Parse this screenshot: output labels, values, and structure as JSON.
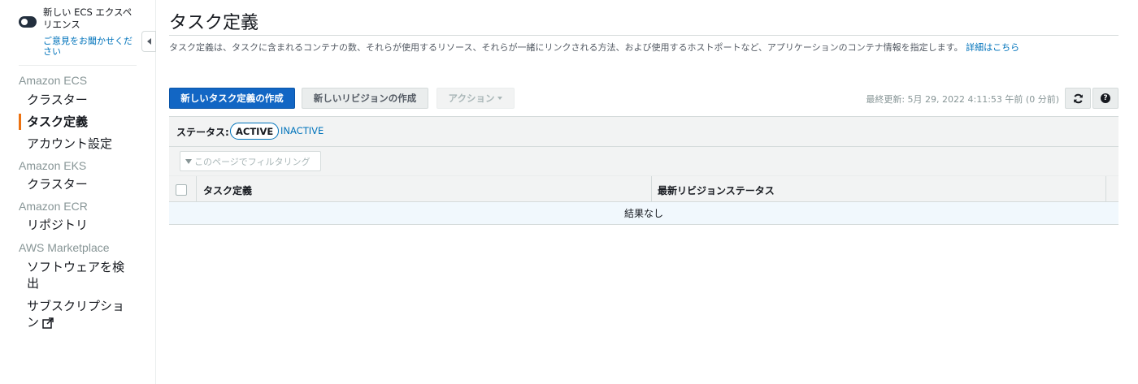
{
  "sidebar": {
    "new_experience": {
      "title": "新しい ECS エクスペリエンス",
      "feedback_link": "ご意見をお聞かせください"
    },
    "sections": [
      {
        "title": "Amazon ECS",
        "items": [
          "クラスター",
          "タスク定義",
          "アカウント設定"
        ]
      },
      {
        "title": "Amazon EKS",
        "items": [
          "クラスター"
        ]
      },
      {
        "title": "Amazon ECR",
        "items": [
          "リポジトリ"
        ]
      },
      {
        "title": "AWS Marketplace",
        "items": [
          "ソフトウェアを検出",
          "サブスクリプション"
        ]
      }
    ],
    "active_item": "タスク定義"
  },
  "main": {
    "title": "タスク定義",
    "description": "タスク定義は、タスクに含まれるコンテナの数、それらが使用するリソース、それらが一緒にリンクされる方法、および使用するホストポートなど、アプリケーションのコンテナ情報を指定します。",
    "learn_more": "詳細はこちら"
  },
  "toolbar": {
    "create_button": "新しいタスク定義の作成",
    "new_revision_button": "新しいリビジョンの作成",
    "actions_button": "アクション",
    "last_updated": "最終更新: 5月 29, 2022 4:11:53 午前 (0 分前)"
  },
  "status": {
    "label": "ステータス:",
    "active": "ACTIVE",
    "inactive": "INACTIVE"
  },
  "filter": {
    "placeholder": "このページでフィルタリング"
  },
  "table": {
    "columns": [
      "タスク定義",
      "最新リビジョンステータス"
    ],
    "empty_text": "結果なし"
  },
  "colors": {
    "primary": "#1266c4",
    "link": "#0073bb",
    "active_marker": "#ec7211"
  }
}
